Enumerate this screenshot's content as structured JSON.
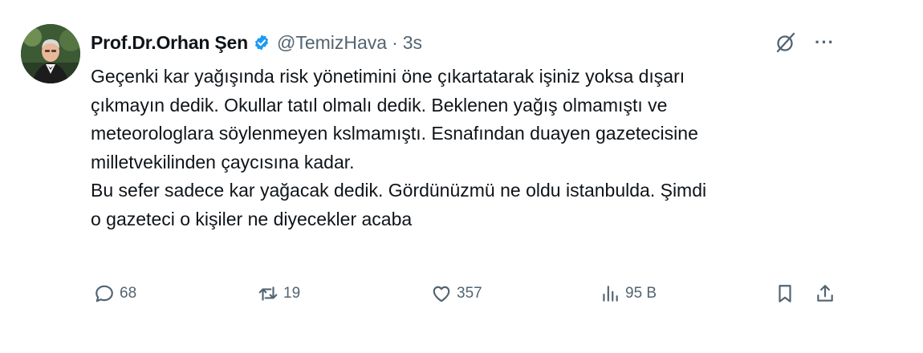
{
  "tweet": {
    "author": {
      "display_name": "Prof.Dr.Orhan Şen",
      "handle": "@TemizHava",
      "separator": "·",
      "timestamp": "3s",
      "verified": true,
      "avatar_icon": "profile-photo",
      "verified_icon": "verified-badge-icon"
    },
    "header_icons": {
      "grok": "grok-icon",
      "more": "···"
    },
    "body_lines": [
      "Geçenki kar yağışında risk yönetimini öne çıkartatarak işiniz yoksa dışarı",
      "çıkmayın dedik. Okullar tatıl olmalı dedik. Beklenen yağış olmamıştı ve",
      "meteorologlara söylenmeyen kslmamıştı. Esnafından duayen gazetecisine",
      "milletvekilinden çaycısına kadar.",
      "Bu sefer sadece kar yağacak dedik. Gördünüzmü ne oldu istanbulda. Şimdi",
      "o gazeteci o kişiler ne diyecekler acaba"
    ],
    "actions": {
      "reply": {
        "icon": "reply-icon",
        "count": "68"
      },
      "retweet": {
        "icon": "retweet-icon",
        "count": "19"
      },
      "like": {
        "icon": "heart-icon",
        "count": "357"
      },
      "views": {
        "icon": "views-icon",
        "count": "95 B"
      },
      "bookmark": {
        "icon": "bookmark-icon"
      },
      "share": {
        "icon": "share-icon"
      }
    }
  },
  "colors": {
    "text_primary": "#0f1419",
    "text_secondary": "#536471",
    "verified_blue": "#1d9bf0",
    "background": "#ffffff"
  }
}
